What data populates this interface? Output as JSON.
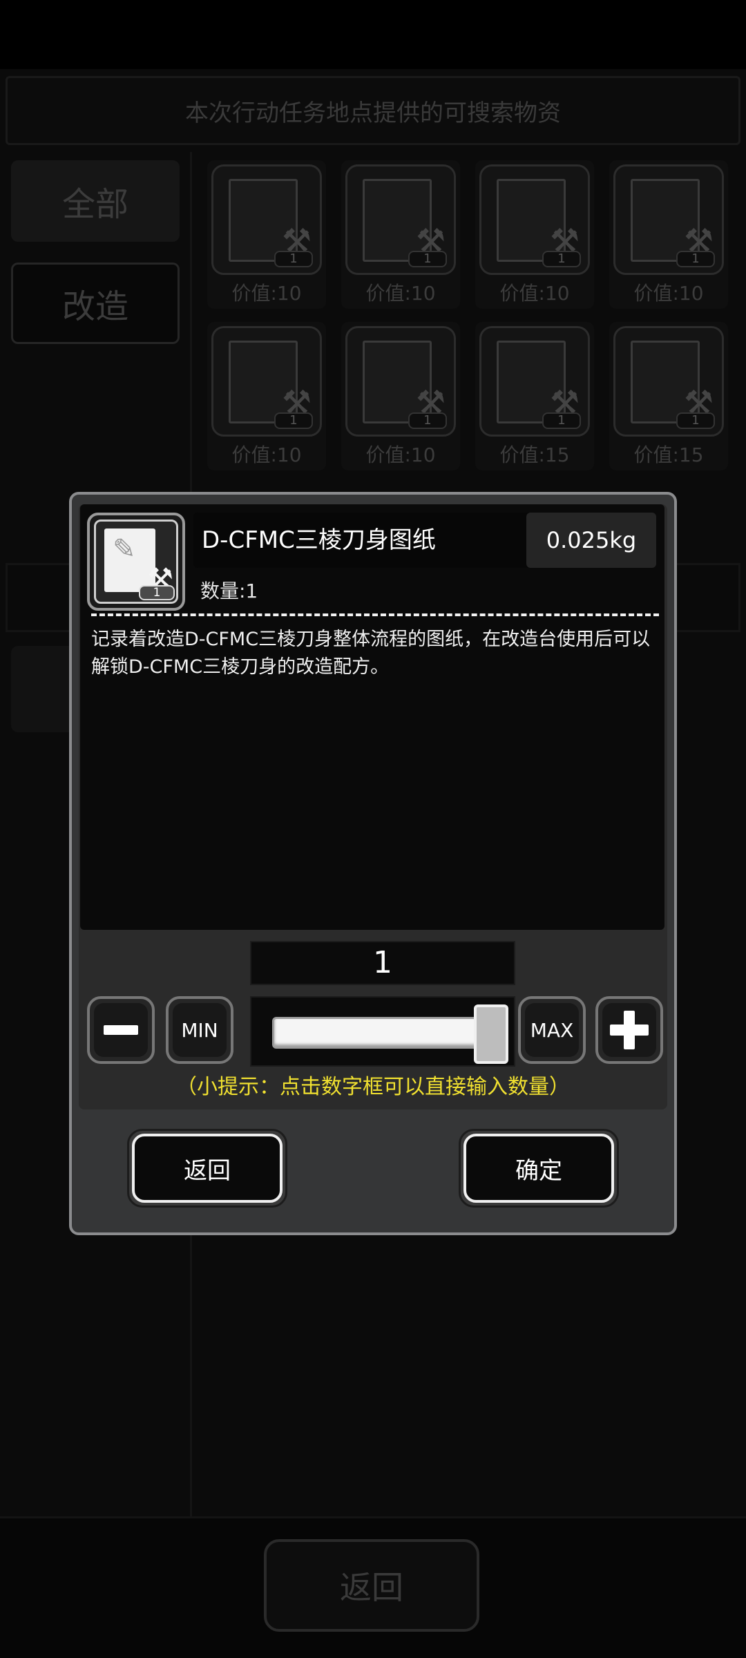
{
  "background": {
    "header_title": "本次行动任务地点提供的可搜索物资",
    "categories": [
      "全部",
      "改造"
    ],
    "items": [
      {
        "price": "价值:10",
        "qty": "1"
      },
      {
        "price": "价值:10",
        "qty": "1"
      },
      {
        "price": "价值:10",
        "qty": "1"
      },
      {
        "price": "价值:10",
        "qty": "1"
      },
      {
        "price": "价值:10",
        "qty": "1"
      },
      {
        "price": "价值:10",
        "qty": "1"
      },
      {
        "price": "价值:15",
        "qty": "1"
      },
      {
        "price": "价值:15",
        "qty": "1"
      }
    ],
    "back_label": "返回"
  },
  "dialog": {
    "item": {
      "name": "D-CFMC三棱刀身图纸",
      "weight": "0.025kg",
      "quantity_label": "数量:1",
      "icon_badge": "1",
      "icon": "blueprint-feather-icon"
    },
    "description": "记录着改造D-CFMC三棱刀身整体流程的图纸，在改造台使用后可以解锁D-CFMC三棱刀身的改造配方。",
    "selector": {
      "value": "1",
      "min_label": "MIN",
      "max_label": "MAX",
      "slider_fraction": 1.0
    },
    "hint": "（小提示：点击数字框可以直接输入数量）",
    "buttons": {
      "back": "返回",
      "confirm": "确定"
    }
  },
  "colors": {
    "hint": "#f0e030",
    "dialog_bg": "#353637",
    "dialog_border": "#8b8c8e"
  }
}
